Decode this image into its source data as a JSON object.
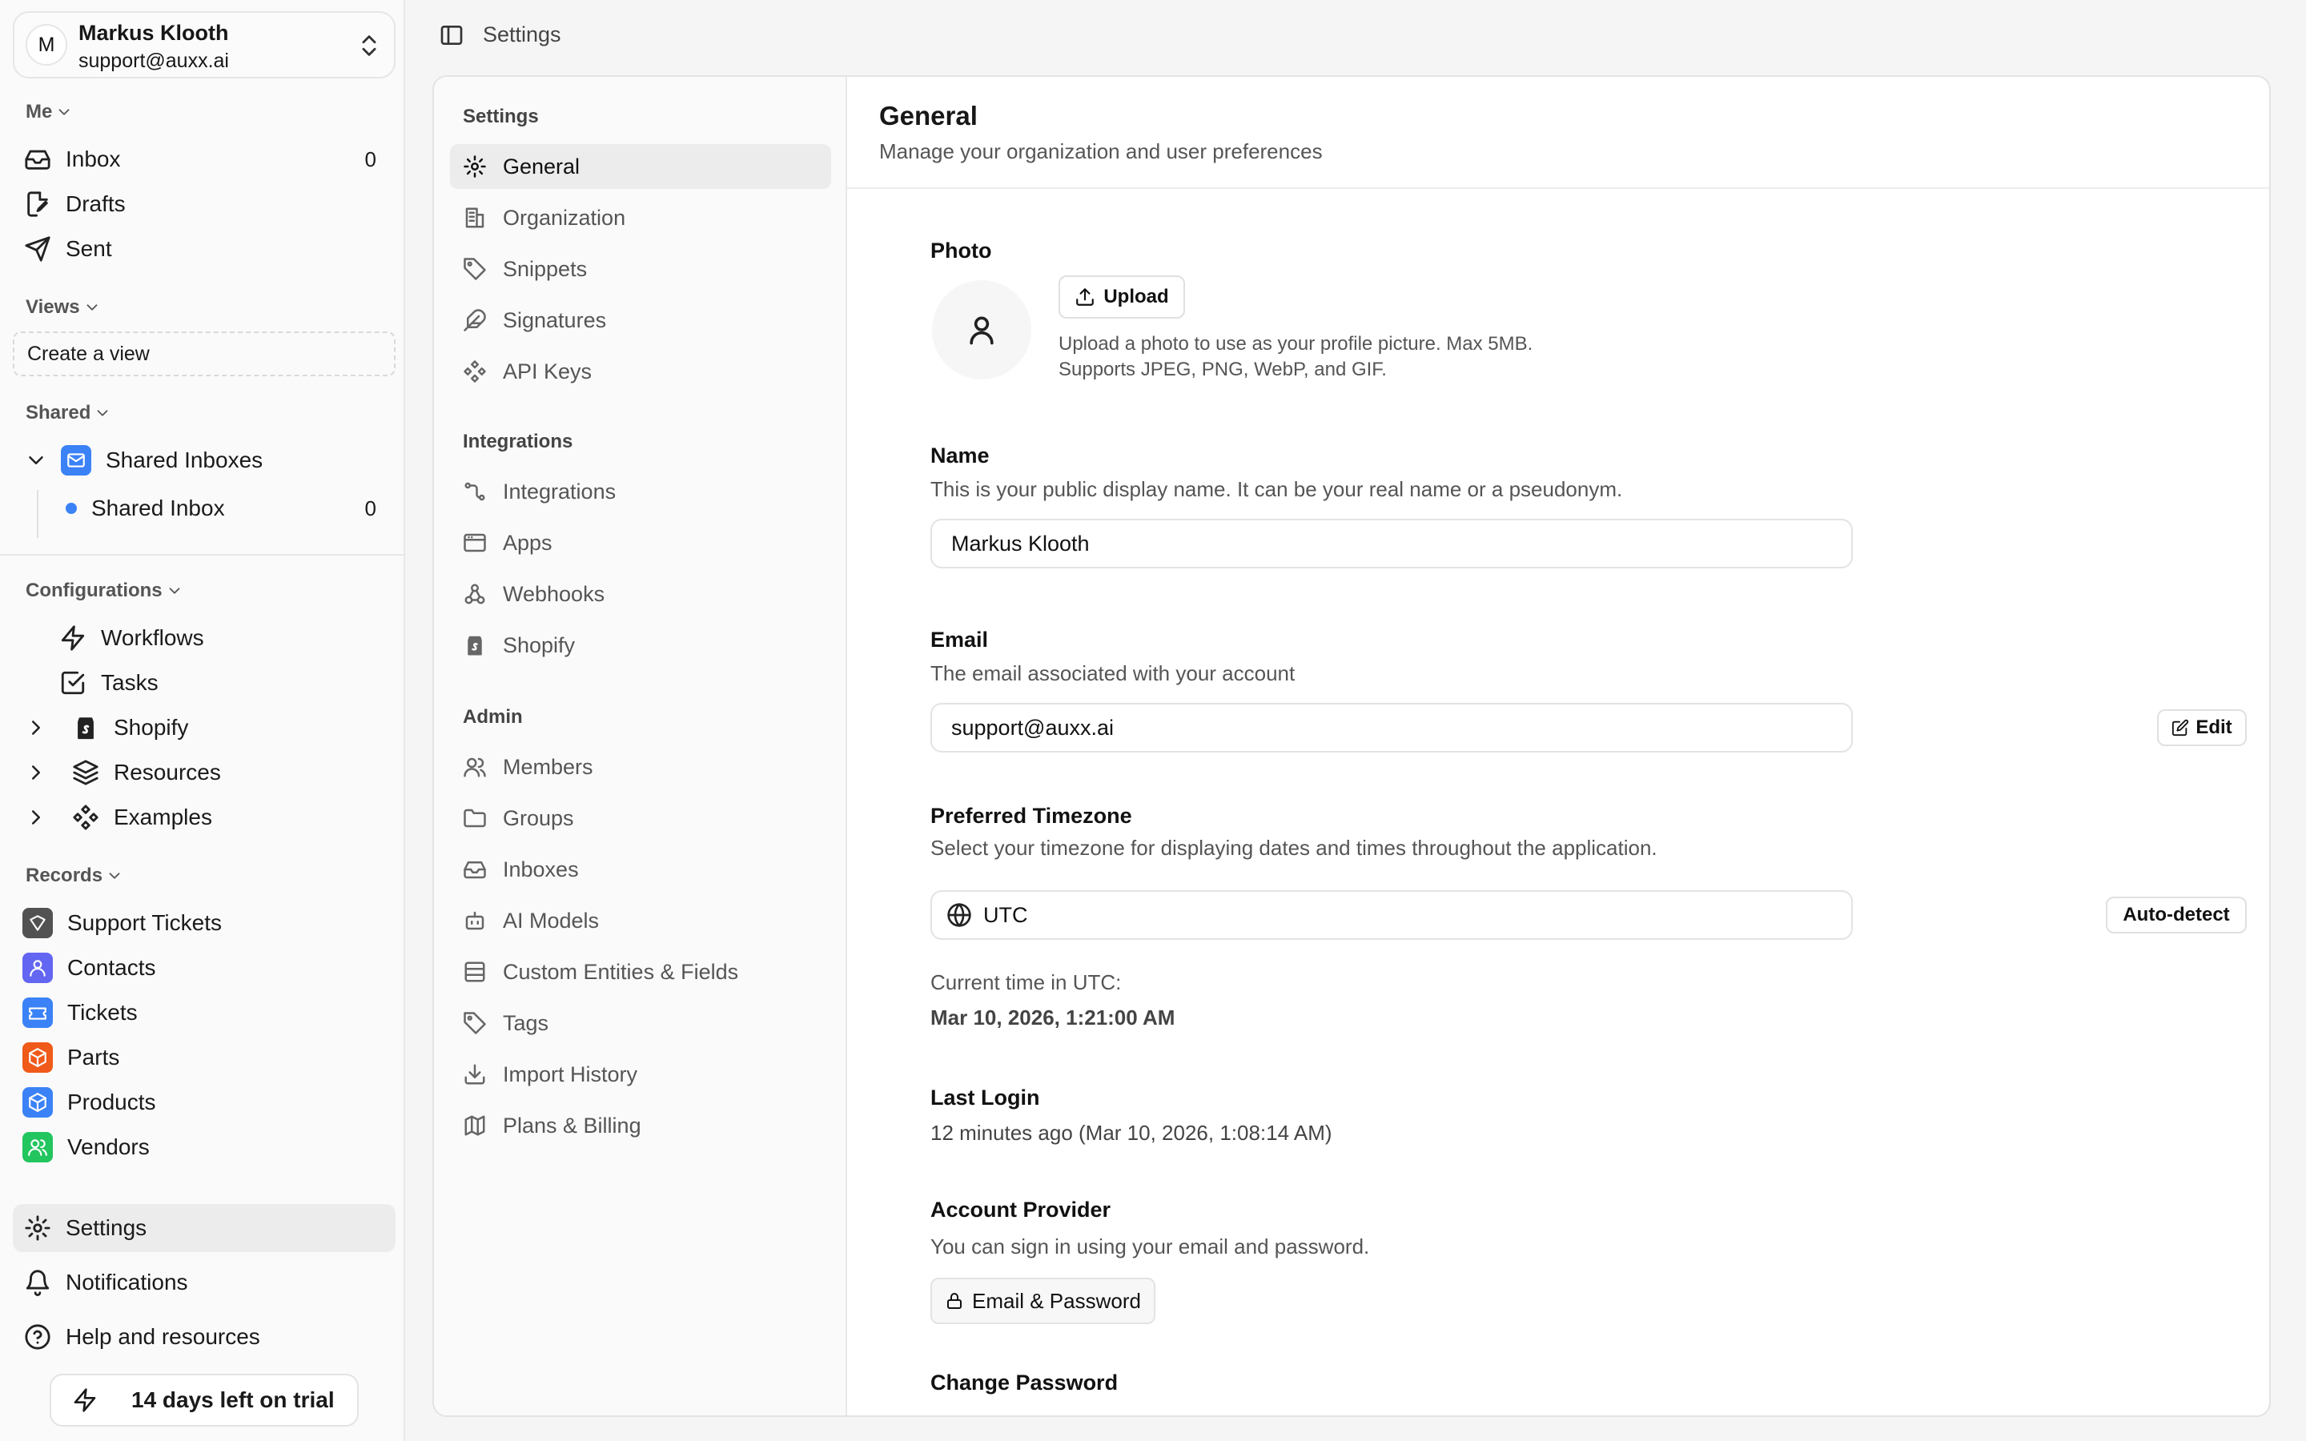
{
  "user": {
    "initial": "M",
    "name": "Markus Klooth",
    "email": "support@auxx.ai"
  },
  "sidebar": {
    "me_label": "Me",
    "inbox": {
      "label": "Inbox",
      "count": "0"
    },
    "drafts": "Drafts",
    "sent": "Sent",
    "views_label": "Views",
    "create_view": "Create a view",
    "shared_label": "Shared",
    "shared_inboxes": "Shared Inboxes",
    "shared_inbox": {
      "label": "Shared Inbox",
      "count": "0"
    },
    "configurations_label": "Configurations",
    "workflows": "Workflows",
    "tasks": "Tasks",
    "shopify": "Shopify",
    "resources": "Resources",
    "examples": "Examples",
    "records_label": "Records",
    "records": [
      {
        "label": "Support Tickets",
        "color": "#525252"
      },
      {
        "label": "Contacts",
        "color": "#6366f1"
      },
      {
        "label": "Tickets",
        "color": "#3b82f6"
      },
      {
        "label": "Parts",
        "color": "#f05a1a"
      },
      {
        "label": "Products",
        "color": "#3b82f6"
      },
      {
        "label": "Vendors",
        "color": "#22c55e"
      }
    ],
    "settings": "Settings",
    "notifications": "Notifications",
    "help": "Help and resources",
    "trial": "14 days left on trial"
  },
  "topbar": {
    "title": "Settings"
  },
  "settings_nav": {
    "settings_heading": "Settings",
    "general": "General",
    "organization": "Organization",
    "snippets": "Snippets",
    "signatures": "Signatures",
    "api_keys": "API Keys",
    "integrations_heading": "Integrations",
    "integrations": "Integrations",
    "apps": "Apps",
    "webhooks": "Webhooks",
    "shopify": "Shopify",
    "admin_heading": "Admin",
    "members": "Members",
    "groups": "Groups",
    "inboxes": "Inboxes",
    "ai_models": "AI Models",
    "custom_entities": "Custom Entities & Fields",
    "tags": "Tags",
    "import_history": "Import History",
    "plans_billing": "Plans & Billing"
  },
  "content": {
    "title": "General",
    "subtitle": "Manage your organization and user preferences",
    "photo": {
      "label": "Photo",
      "upload": "Upload",
      "hint1": "Upload a photo to use as your profile picture. Max 5MB.",
      "hint2": "Supports JPEG, PNG, WebP, and GIF."
    },
    "name": {
      "label": "Name",
      "desc": "This is your public display name. It can be your real name or a pseudonym.",
      "value": "Markus Klooth"
    },
    "email": {
      "label": "Email",
      "desc": "The email associated with your account",
      "value": "support@auxx.ai",
      "edit": "Edit"
    },
    "timezone": {
      "label": "Preferred Timezone",
      "desc": "Select your timezone for displaying dates and times throughout the application.",
      "value": "UTC",
      "auto_detect": "Auto-detect",
      "current_label": "Current time in UTC:",
      "current_value": "Mar 10, 2026, 1:21:00 AM"
    },
    "last_login": {
      "label": "Last Login",
      "value": "12 minutes ago (Mar 10, 2026, 1:08:14 AM)"
    },
    "provider": {
      "label": "Account Provider",
      "desc": "You can sign in using your email and password.",
      "button": "Email & Password"
    },
    "change_password": {
      "label": "Change Password"
    }
  }
}
